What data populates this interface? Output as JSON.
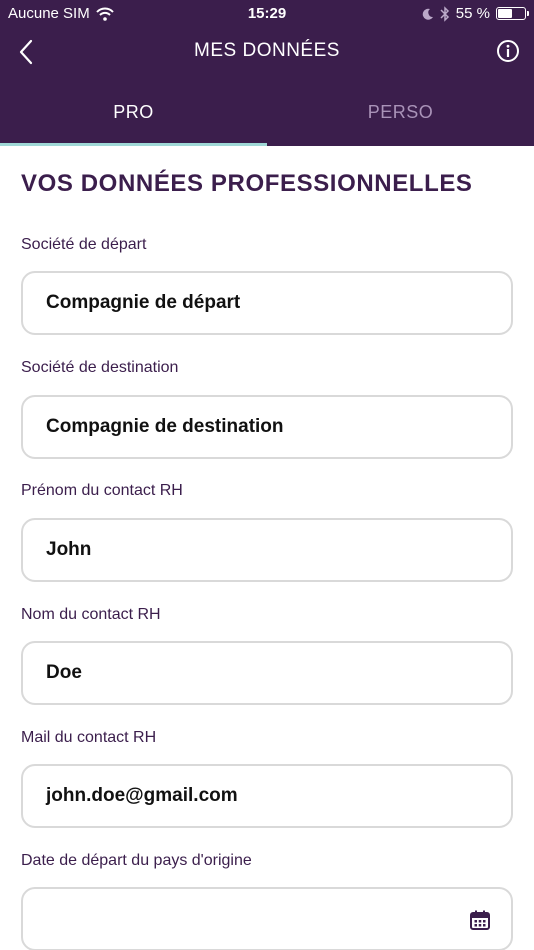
{
  "status_bar": {
    "carrier": "Aucune SIM",
    "time": "15:29",
    "battery_percent": "55 %",
    "battery_level": 0.55,
    "icons": [
      "wifi-icon",
      "moon-icon",
      "bluetooth-icon",
      "battery-icon"
    ]
  },
  "nav": {
    "title": "MES DONNÉES",
    "back_icon": "chevron-left-icon",
    "info_icon": "info-icon"
  },
  "tabs": [
    {
      "label": "PRO",
      "active": true
    },
    {
      "label": "PERSO",
      "active": false
    }
  ],
  "section": {
    "title": "VOS DONNÉES PROFESSIONNELLES"
  },
  "fields": [
    {
      "label": "Société de départ",
      "value": "Compagnie de départ"
    },
    {
      "label": "Société de destination",
      "value": "Compagnie de destination"
    },
    {
      "label": "Prénom du contact RH",
      "value": "John"
    },
    {
      "label": "Nom du contact RH",
      "value": "Doe"
    },
    {
      "label": "Mail du contact RH",
      "value": "john.doe@gmail.com"
    },
    {
      "label": "Date de départ du pays d'origine",
      "value": "",
      "icon": "calendar-icon"
    }
  ],
  "colors": {
    "header_bg": "#3b1e4c",
    "accent_underline": "#9fd8d6",
    "inactive_tab": "#a993b8",
    "field_border": "#d9d9d9"
  }
}
